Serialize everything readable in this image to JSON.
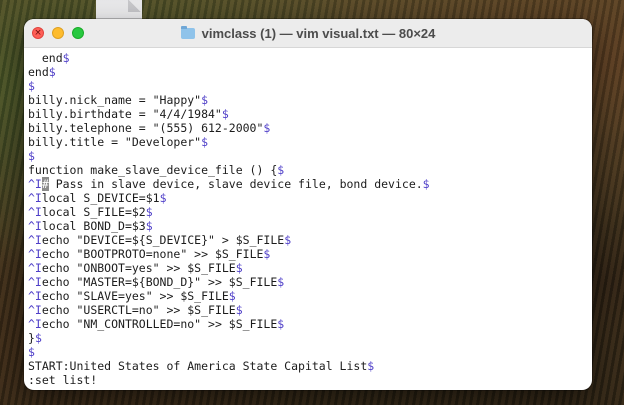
{
  "window": {
    "title": "vimclass (1) — vim visual.txt — 80×24",
    "close_glyph": "×"
  },
  "editor": {
    "eol_marker": "$",
    "tab_marker": "^I",
    "lines": [
      {
        "text": "  end",
        "eol": true
      },
      {
        "text": "end",
        "eol": true
      },
      {
        "text": "",
        "eol": true
      },
      {
        "text": "billy.nick_name = \"Happy\"",
        "eol": true
      },
      {
        "text": "billy.birthdate = \"4/4/1984\"",
        "eol": true
      },
      {
        "text": "billy.telephone = \"(555) 612-2000\"",
        "eol": true
      },
      {
        "text": "billy.title = \"Developer\"",
        "eol": true
      },
      {
        "text": "",
        "eol": true
      },
      {
        "text": "function make_slave_device_file () {",
        "eol": true
      },
      {
        "tab": true,
        "cursor": "#",
        "text": " Pass in slave device, slave device file, bond device.",
        "eol": true
      },
      {
        "tab": true,
        "text": "local S_DEVICE=$1",
        "eol": true
      },
      {
        "tab": true,
        "text": "local S_FILE=$2",
        "eol": true
      },
      {
        "tab": true,
        "text": "local BOND_D=$3",
        "eol": true
      },
      {
        "tab": true,
        "text": "echo \"DEVICE=${S_DEVICE}\" > $S_FILE",
        "eol": true
      },
      {
        "tab": true,
        "text": "echo \"BOOTPROTO=none\" >> $S_FILE",
        "eol": true
      },
      {
        "tab": true,
        "text": "echo \"ONBOOT=yes\" >> $S_FILE",
        "eol": true
      },
      {
        "tab": true,
        "text": "echo \"MASTER=${BOND_D}\" >> $S_FILE",
        "eol": true
      },
      {
        "tab": true,
        "text": "echo \"SLAVE=yes\" >> $S_FILE",
        "eol": true
      },
      {
        "tab": true,
        "text": "echo \"USERCTL=no\" >> $S_FILE",
        "eol": true
      },
      {
        "tab": true,
        "text": "echo \"NM_CONTROLLED=no\" >> $S_FILE",
        "eol": true
      },
      {
        "text": "}",
        "eol": true
      },
      {
        "text": "",
        "eol": true
      },
      {
        "text": "START:United States of America State Capital List",
        "eol": true
      }
    ],
    "command_line": ":set list!"
  }
}
